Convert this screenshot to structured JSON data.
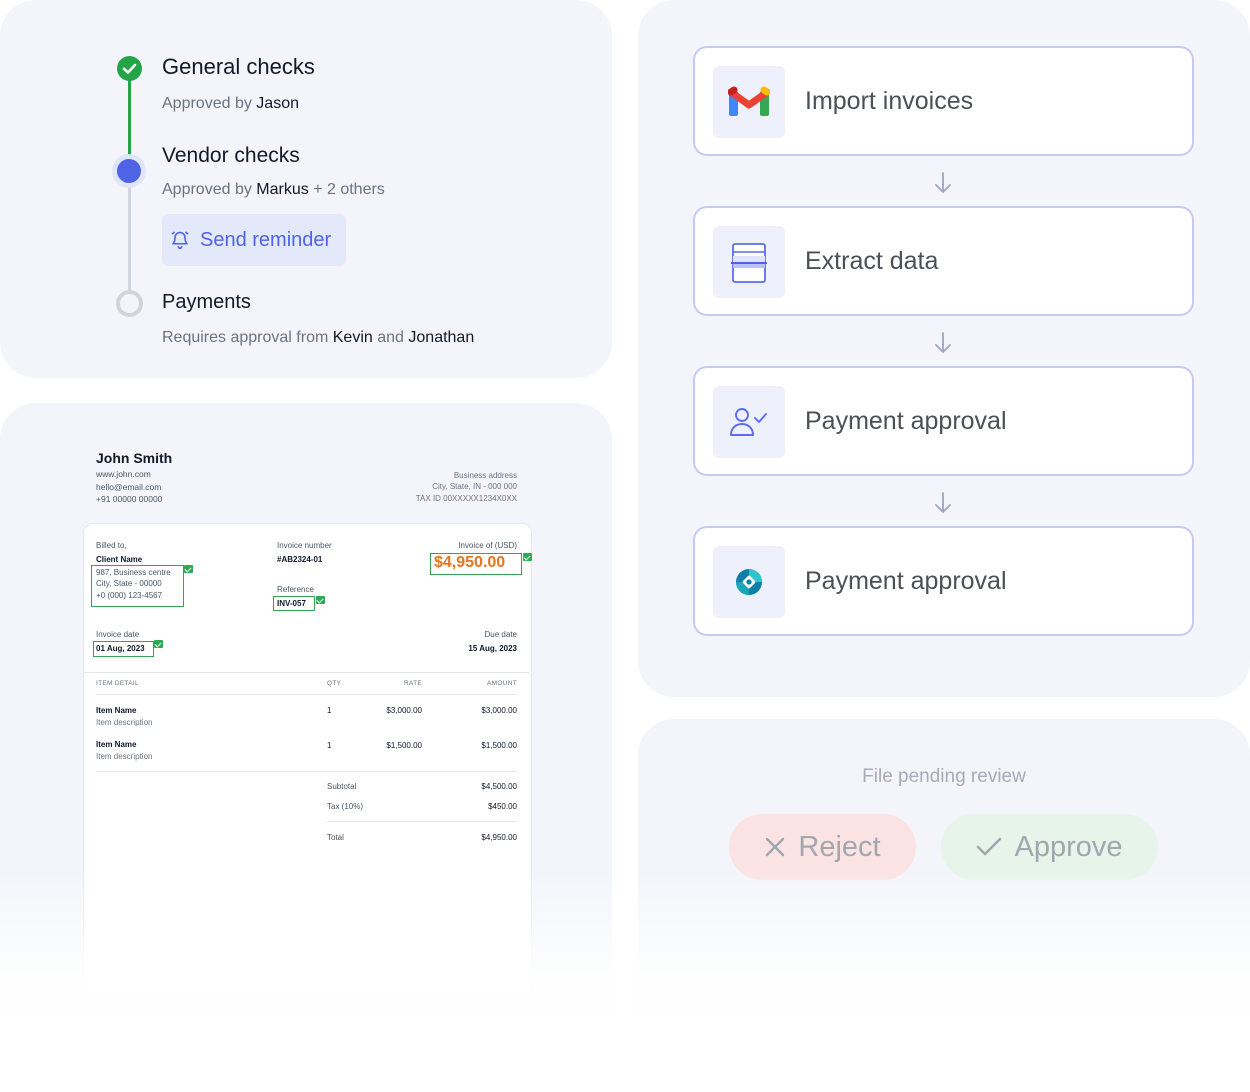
{
  "approvals": {
    "steps": [
      {
        "title": "General checks",
        "prefix": "Approved by",
        "approver": "Jason"
      },
      {
        "title": "Vendor checks",
        "prefix": "Approved by",
        "approver": "Markus",
        "extra": "+ 2 others",
        "button_label": "Send reminder"
      },
      {
        "title": "Payments",
        "prefix": "Requires approval from",
        "approver1": "Kevin",
        "conj": "and",
        "approver2": "Jonathan"
      }
    ],
    "colors": {
      "done": "#22a447",
      "active": "#4f63e6",
      "pending": "#d1d5db"
    }
  },
  "invoice": {
    "sender": {
      "name": "John Smith",
      "website": "www.john.com",
      "email": "hello@email.com",
      "phone": "+91 00000 00000"
    },
    "business": {
      "label": "Business address",
      "city": "City, State, IN - 000 000",
      "tax": "TAX ID 00XXXXX1234X0XX"
    },
    "billed_to": {
      "label": "Billed to,",
      "client": "Client Name",
      "address1": "987, Business centre",
      "address2": "City, State - 00000",
      "phone": "+0 (000) 123-4567"
    },
    "invoice_number": {
      "label": "Invoice number",
      "value": "#AB2324-01"
    },
    "reference": {
      "label": "Reference",
      "value": "INV-057"
    },
    "invoice_of": {
      "label": "Invoice of (USD)",
      "value": "$4,950.00"
    },
    "invoice_date": {
      "label": "Invoice date",
      "value": "01 Aug, 2023"
    },
    "due_date": {
      "label": "Due date",
      "value": "15 Aug, 2023"
    },
    "columns": {
      "item": "ITEM DETAIL",
      "qty": "QTY",
      "rate": "RATE",
      "amount": "AMOUNT"
    },
    "items": [
      {
        "name": "Item Name",
        "desc": "Item description",
        "qty": "1",
        "rate": "$3,000.00",
        "amount": "$3,000.00"
      },
      {
        "name": "Item Name",
        "desc": "Item description",
        "qty": "1",
        "rate": "$1,500.00",
        "amount": "$1,500.00"
      }
    ],
    "subtotal": {
      "label": "Subtotal",
      "value": "$4,500.00"
    },
    "tax": {
      "label": "Tax (10%)",
      "value": "$450.00"
    },
    "total": {
      "label": "Total",
      "value": "$4,950.00"
    },
    "accent": "#e8731c"
  },
  "workflow": {
    "steps": [
      {
        "label": "Import invoices",
        "icon": "gmail-icon"
      },
      {
        "label": "Extract data",
        "icon": "document-scan-icon"
      },
      {
        "label": "Payment approval",
        "icon": "user-check-icon"
      },
      {
        "label": "Payment approval",
        "icon": "dynamics-icon"
      }
    ],
    "arrow_icon": "arrow-down-icon"
  },
  "review": {
    "status": "File pending review",
    "reject_label": "Reject",
    "approve_label": "Approve"
  }
}
